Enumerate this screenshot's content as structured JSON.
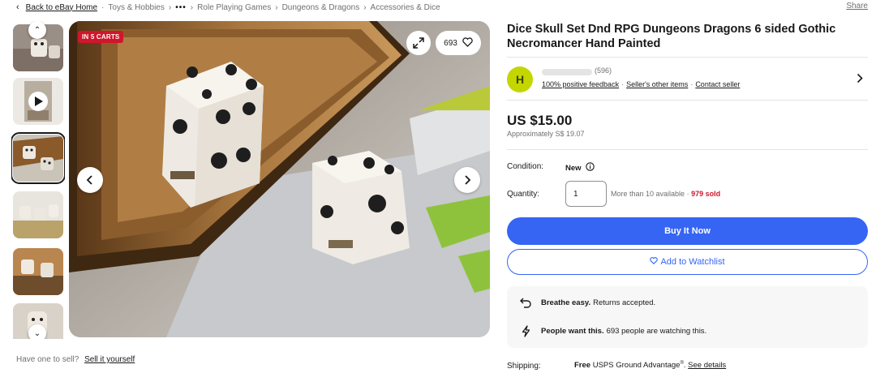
{
  "breadcrumb": {
    "back_label": "Back to eBay Home",
    "items": [
      "Toys & Hobbies",
      "Role Playing Games",
      "Dungeons & Dragons",
      "Accessories & Dice"
    ],
    "ellipsis": "•••"
  },
  "share_label": "Share",
  "gallery": {
    "badge": "IN 5 CARTS",
    "watch_count": "693",
    "selected_thumb": 3
  },
  "sell_prompt": {
    "text": "Have one to sell?",
    "link": "Sell it yourself"
  },
  "listing": {
    "title": "Dice Skull Set Dnd RPG Dungeons Dragons 6 sided Gothic Necromancer Hand Painted"
  },
  "seller": {
    "initial": "H",
    "feedback_count": "(596)",
    "positive_feedback": "100% positive feedback",
    "other_items": "Seller's other items",
    "contact": "Contact seller"
  },
  "price": {
    "main": "US $15.00",
    "approx": "Approximately S$ 19.07"
  },
  "condition": {
    "label": "Condition:",
    "value": "New"
  },
  "quantity": {
    "label": "Quantity:",
    "value": "1",
    "available": "More than 10 available",
    "separator": " · ",
    "sold": "979 sold"
  },
  "actions": {
    "buy_now": "Buy It Now",
    "watchlist": "Add to Watchlist"
  },
  "highlights": [
    {
      "bold": "Breathe easy.",
      "text": "Returns accepted."
    },
    {
      "bold": "People want this.",
      "text": "693 people are watching this."
    }
  ],
  "shipping": {
    "label": "Shipping:",
    "free": "Free",
    "service": "USPS Ground Advantage",
    "mark": "®",
    "details_link": "See details"
  },
  "colors": {
    "ebay_blue": "#3665f3",
    "badge_red": "#d0162b",
    "avatar_green": "#c3d600"
  }
}
